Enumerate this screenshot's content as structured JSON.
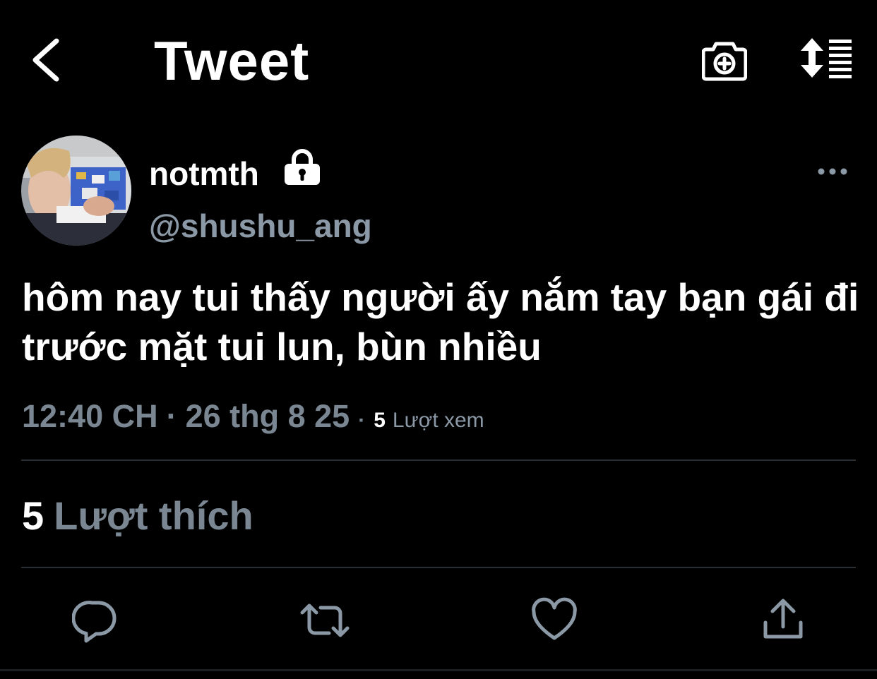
{
  "header": {
    "title": "Tweet",
    "icons": [
      "chevron-left-icon",
      "camera-plus-icon",
      "sort-lines-icon"
    ]
  },
  "tweet": {
    "display_name": "notmth",
    "handle": "@shushu_ang",
    "protected_icon": "lock-icon",
    "text": "hôm nay tui thấy người ấy nắm tay bạn gái đi trước mặt tui lun, bùn nhiều",
    "time": "12:40 CH",
    "date": "26 thg 8 25",
    "separator": "·",
    "views_count": "5",
    "views_label": "Lượt xem",
    "likes_count": "5",
    "likes_label": "Lượt thích"
  },
  "actions": [
    "reply-icon",
    "retweet-icon",
    "like-icon",
    "share-icon"
  ],
  "colors": {
    "background": "#000000",
    "primary_text": "#ffffff",
    "secondary_text": "#8b98a5",
    "divider": "#2a2f33"
  }
}
